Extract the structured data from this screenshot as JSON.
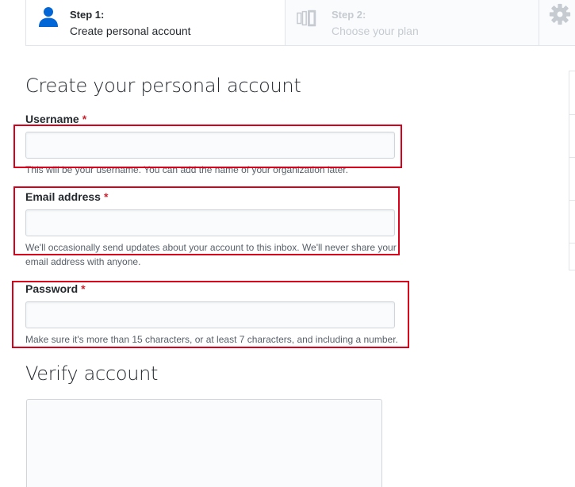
{
  "steps": [
    {
      "title": "Step 1:",
      "description": "Create personal account",
      "icon": "person-icon",
      "active": true
    },
    {
      "title": "Step 2:",
      "description": "Choose your plan",
      "icon": "plan-icon",
      "active": false
    },
    {
      "icon": "gear-icon",
      "active": false
    }
  ],
  "form": {
    "heading": "Create your personal account",
    "username": {
      "label": "Username",
      "required_mark": "*",
      "value": "",
      "note": "This will be your username. You can add the name of your organization later."
    },
    "email": {
      "label": "Email address",
      "required_mark": "*",
      "value": "",
      "note": "We'll occasionally send updates about your account to this inbox. We'll never share your email address with anyone."
    },
    "password": {
      "label": "Password",
      "required_mark": "*",
      "value": "",
      "note": "Make sure it's more than 15 characters, or at least 7 characters, and including a number."
    }
  },
  "verify": {
    "heading": "Verify account"
  },
  "colors": {
    "active_icon": "#0366d6",
    "inactive": "#c6cbd1",
    "required": "#cb2431",
    "highlight": "#d9001b"
  }
}
